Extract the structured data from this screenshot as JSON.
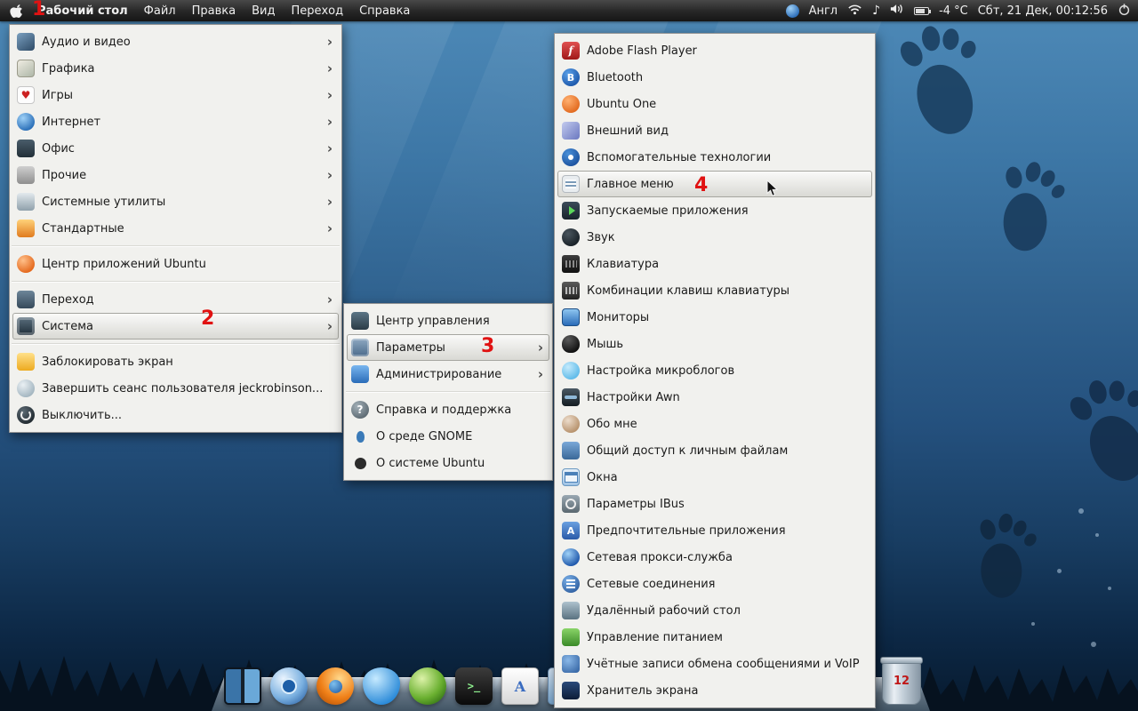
{
  "menubar": {
    "title": "Рабочий стол",
    "menus": [
      "Файл",
      "Правка",
      "Вид",
      "Переход",
      "Справка"
    ],
    "status": {
      "keyboard_layout": "Англ",
      "temperature": "-4 °C",
      "clock": "Сбт, 21 Дек, 00:12:56"
    },
    "icons": [
      "apple-logo",
      "keyboard-indicator",
      "wifi",
      "music-note",
      "volume",
      "battery",
      "power"
    ]
  },
  "menu1": {
    "items": [
      {
        "label": "Аудио и видео",
        "icon": "audio-video",
        "submenu": true
      },
      {
        "label": "Графика",
        "icon": "graphics",
        "submenu": true
      },
      {
        "label": "Игры",
        "icon": "games",
        "submenu": true
      },
      {
        "label": "Интернет",
        "icon": "internet",
        "submenu": true
      },
      {
        "label": "Офис",
        "icon": "office",
        "submenu": true
      },
      {
        "label": "Прочие",
        "icon": "other-apps",
        "submenu": true
      },
      {
        "label": "Системные утилиты",
        "icon": "system-tools",
        "submenu": true
      },
      {
        "label": "Стандартные",
        "icon": "accessories",
        "submenu": true
      },
      {
        "label": "Центр приложений Ubuntu",
        "icon": "ubuntu-software-center",
        "submenu": false
      },
      {
        "label": "Переход",
        "icon": "places",
        "submenu": true
      },
      {
        "label": "Система",
        "icon": "system",
        "submenu": true,
        "highlighted": true
      },
      {
        "label": "Заблокировать экран",
        "icon": "lock-screen",
        "submenu": false
      },
      {
        "label": "Завершить сеанс пользователя jeckrobinson...",
        "icon": "log-out",
        "submenu": false
      },
      {
        "label": "Выключить...",
        "icon": "shut-down",
        "submenu": false
      }
    ]
  },
  "menu2": {
    "items": [
      {
        "label": "Центр управления",
        "icon": "control-center",
        "submenu": false
      },
      {
        "label": "Параметры",
        "icon": "preferences",
        "submenu": true,
        "highlighted": true
      },
      {
        "label": "Администрирование",
        "icon": "administration",
        "submenu": true
      },
      {
        "label": "Справка и поддержка",
        "icon": "help",
        "submenu": false
      },
      {
        "label": "О среде GNOME",
        "icon": "about-gnome",
        "submenu": false
      },
      {
        "label": "О системе Ubuntu",
        "icon": "about-ubuntu",
        "submenu": false
      }
    ]
  },
  "menu3": {
    "items": [
      {
        "label": "Adobe Flash Player",
        "icon": "flash-player"
      },
      {
        "label": "Bluetooth",
        "icon": "bluetooth"
      },
      {
        "label": "Ubuntu One",
        "icon": "ubuntu-one"
      },
      {
        "label": "Внешний вид",
        "icon": "appearance"
      },
      {
        "label": "Вспомогательные технологии",
        "icon": "assistive-technologies"
      },
      {
        "label": "Главное меню",
        "icon": "main-menu",
        "highlighted": true
      },
      {
        "label": "Запускаемые приложения",
        "icon": "startup-applications"
      },
      {
        "label": "Звук",
        "icon": "sound"
      },
      {
        "label": "Клавиатура",
        "icon": "keyboard"
      },
      {
        "label": "Комбинации клавиш клавиатуры",
        "icon": "keyboard-shortcuts"
      },
      {
        "label": "Мониторы",
        "icon": "monitors"
      },
      {
        "label": "Мышь",
        "icon": "mouse"
      },
      {
        "label": "Настройка микроблогов",
        "icon": "microblogging"
      },
      {
        "label": "Настройки Awn",
        "icon": "awn-settings"
      },
      {
        "label": "Обо мне",
        "icon": "about-me"
      },
      {
        "label": "Общий доступ к личным файлам",
        "icon": "personal-file-sharing"
      },
      {
        "label": "Окна",
        "icon": "windows"
      },
      {
        "label": "Параметры IBus",
        "icon": "ibus-preferences"
      },
      {
        "label": "Предпочтительные приложения",
        "icon": "preferred-applications"
      },
      {
        "label": "Сетевая прокси-служба",
        "icon": "network-proxy"
      },
      {
        "label": "Сетевые соединения",
        "icon": "network-connections"
      },
      {
        "label": "Удалённый рабочий стол",
        "icon": "remote-desktop"
      },
      {
        "label": "Управление питанием",
        "icon": "power-management"
      },
      {
        "label": "Учётные записи обмена сообщениями и VoIP",
        "icon": "messaging-voip-accounts"
      },
      {
        "label": "Хранитель экрана",
        "icon": "screensaver"
      }
    ]
  },
  "dock": {
    "apps": [
      {
        "icon": "workspace-switcher"
      },
      {
        "icon": "chromium-browser"
      },
      {
        "icon": "firefox-browser"
      },
      {
        "icon": "water-drop-app"
      },
      {
        "icon": "green-orb-app"
      },
      {
        "icon": "terminal"
      },
      {
        "icon": "document-editor"
      },
      {
        "icon": "blue-document-app"
      }
    ],
    "trash_count": "12"
  },
  "annotations": [
    "1",
    "2",
    "3",
    "4"
  ]
}
